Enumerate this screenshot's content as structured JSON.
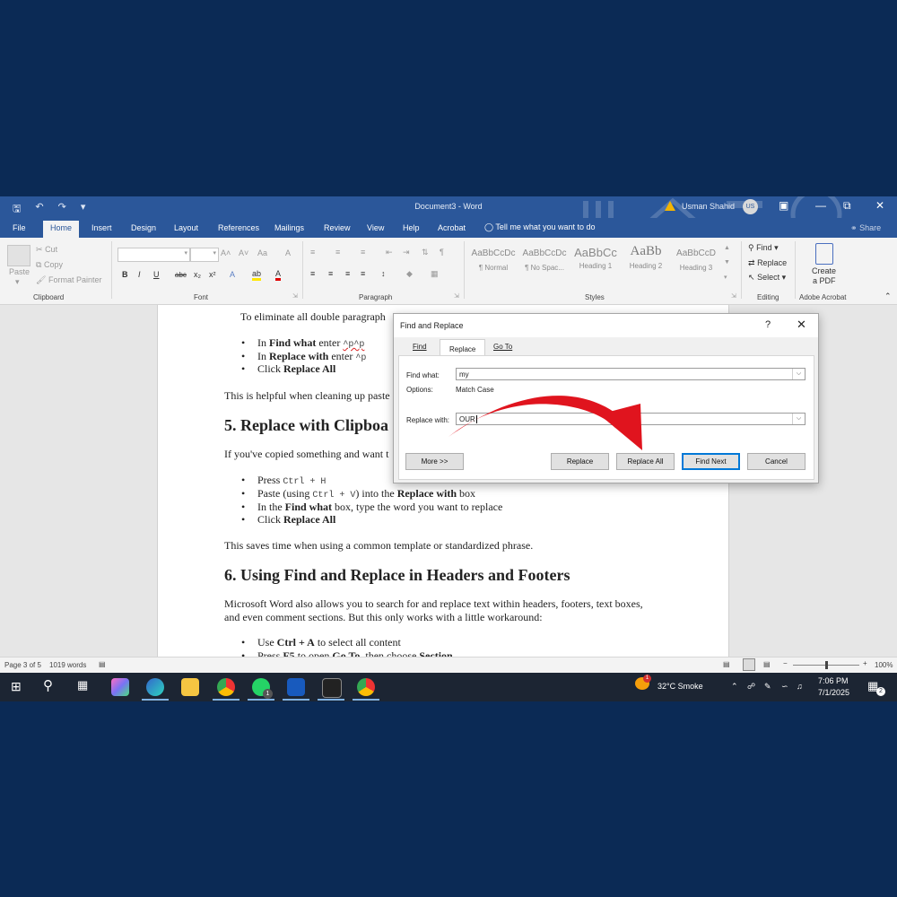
{
  "titlebar": {
    "doc_title": "Document3  -  Word",
    "user_name": "Usman Shahid",
    "user_initials": "US"
  },
  "menu": {
    "tabs": [
      "File",
      "Home",
      "Insert",
      "Design",
      "Layout",
      "References",
      "Mailings",
      "Review",
      "View",
      "Help",
      "Acrobat"
    ],
    "active_tab": "Home",
    "tell_me": "Tell me what you want to do",
    "share": "Share"
  },
  "ribbon": {
    "clipboard": {
      "paste": "Paste",
      "cut": "Cut",
      "copy": "Copy",
      "format_painter": "Format Painter",
      "label": "Clipboard"
    },
    "font": {
      "label": "Font",
      "bold": "B",
      "italic": "I",
      "underline": "U",
      "strike": "abc",
      "sub": "x₂",
      "sup": "x²",
      "grow": "A˄",
      "shrink": "A˅",
      "case": "Aa",
      "clear": "A",
      "effects": "A",
      "highlight": "ab",
      "color": "A"
    },
    "paragraph": {
      "label": "Paragraph"
    },
    "styles": {
      "label": "Styles",
      "items": [
        {
          "sample": "AaBbCcDc",
          "name": "¶ Normal"
        },
        {
          "sample": "AaBbCcDc",
          "name": "¶ No Spac..."
        },
        {
          "sample": "AaBbCc",
          "name": "Heading 1"
        },
        {
          "sample": "AaBb",
          "name": "Heading 2"
        },
        {
          "sample": "AaBbCcD",
          "name": "Heading 3"
        }
      ]
    },
    "editing": {
      "find": "Find",
      "replace": "Replace",
      "select": "Select",
      "label": "Editing"
    },
    "acrobat": {
      "create1": "Create",
      "create2": "a PDF",
      "label": "Adobe Acrobat"
    }
  },
  "document": {
    "line1": "To eliminate all double paragraph",
    "b1_pre": "In ",
    "b1_bold": "Find what",
    "b1_mid": " enter ",
    "b1_code": "^p^p",
    "b2_pre": "In ",
    "b2_bold": "Replace with",
    "b2_mid": " enter ",
    "b2_code": "^p",
    "b3_pre": "Click ",
    "b3_bold": "Replace All",
    "para2": "This is helpful when cleaning up paste",
    "h5": "5. Replace with Clipboa",
    "para3": "If you've copied something and want t",
    "c1_pre": "Press ",
    "c1_code": "Ctrl + H",
    "c2_pre": "Paste (using ",
    "c2_code": "Ctrl + V",
    "c2_mid": ") into the ",
    "c2_bold": "Replace with",
    "c2_post": " box",
    "c3_pre": "In the ",
    "c3_bold": "Find what",
    "c3_post": " box, type the word you want to replace",
    "c4_pre": "Click ",
    "c4_bold": "Replace All",
    "para4": "This saves time when using a common template or standardized phrase.",
    "h6": "6. Using Find and Replace in Headers and Footers",
    "para5a": "Microsoft Word also allows you to search for and replace text within headers, footers, text boxes,",
    "para5b": "and even comment sections. But this only works with a little workaround:",
    "d1_pre": "Use ",
    "d1_bold": "Ctrl + A",
    "d1_post": " to select all content",
    "d2_pre": "Press ",
    "d2_bold": "F5",
    "d2_mid": " to open ",
    "d2_bold2": "Go To",
    "d2_mid2": ", then choose ",
    "d2_bold3": "Section"
  },
  "dialog": {
    "title": "Find and Replace",
    "help": "?",
    "close": "✕",
    "tabs": {
      "find": "Find",
      "replace": "Replace",
      "goto": "Go To"
    },
    "active_tab": "Replace",
    "find_label": "Find what:",
    "find_value": "my",
    "options_label": "Options:",
    "options_value": "Match Case",
    "replace_label": "Replace with:",
    "replace_value": "OUR",
    "buttons": {
      "more": "More >>",
      "replace": "Replace",
      "replace_all": "Replace All",
      "find_next": "Find Next",
      "cancel": "Cancel"
    },
    "arrow_color": "#e0141e"
  },
  "statusbar": {
    "page": "Page 3 of 5",
    "words": "1019 words",
    "zoom_minus": "−",
    "zoom_plus": "+",
    "zoom": "100%",
    "zoom_level": 0.5
  },
  "taskbar": {
    "weather": "32°C  Smoke",
    "weather_badge": "1",
    "whatsapp_badge": "1",
    "time": "7:06 PM",
    "date": "7/1/2025",
    "notif_count": "2"
  },
  "colors": {
    "word_blue": "#2b579a",
    "backdrop": "#0b2a55",
    "taskbar": "#1c2533"
  }
}
